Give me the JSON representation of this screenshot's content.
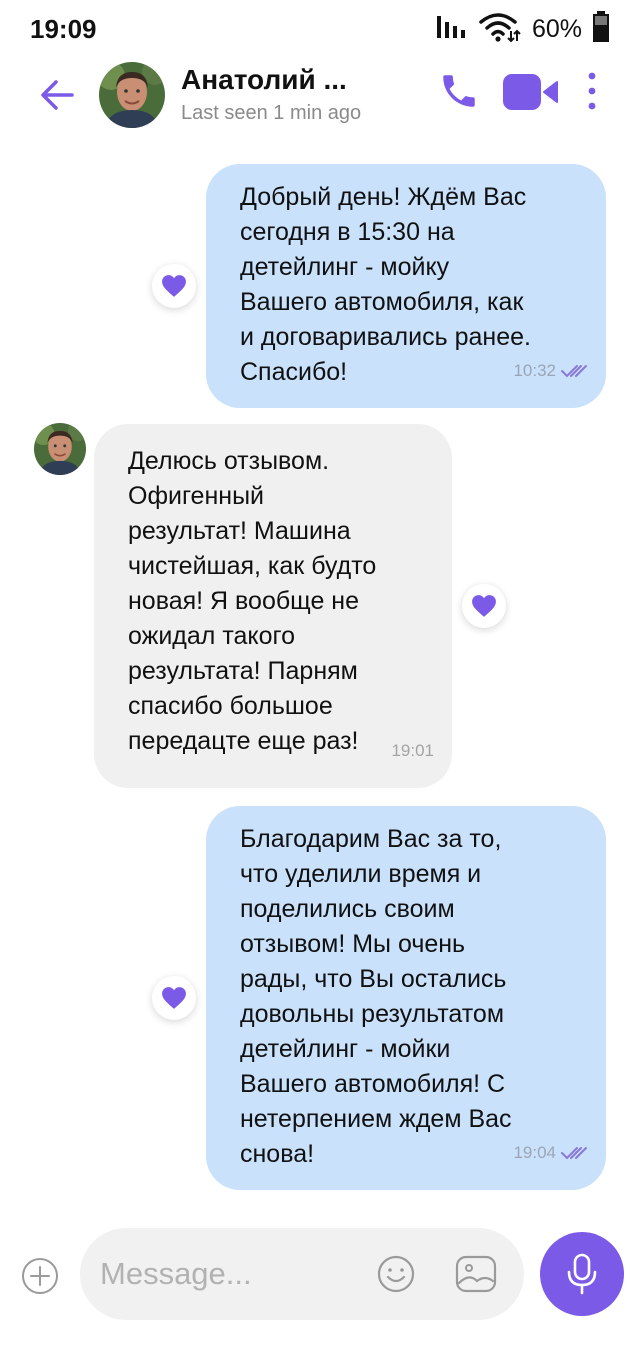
{
  "status_bar": {
    "time": "19:09",
    "battery_percent": "60%"
  },
  "header": {
    "contact_name": "Анатолий ...",
    "last_seen": "Last seen 1 min ago"
  },
  "messages": [
    {
      "direction": "outgoing",
      "text": "Добрый день! Ждём Вас\nсегодня в 15:30 на\nдетейлинг - мойку\nВашего автомобиля, как\nи договаривались ранее.\nСпасибо!",
      "time": "10:32",
      "read": true,
      "reaction": "heart"
    },
    {
      "direction": "incoming",
      "text": "Делюсь отзывом.\nОфигенный\nрезультат! Машина\nчистейшая, как будто\nновая! Я вообще не\nожидал такого\nрезультата! Парням\nспасибо большое\nпередацте еще раз!",
      "time": "19:01",
      "reaction": "heart"
    },
    {
      "direction": "outgoing",
      "text": "Благодарим Вас за то,\nчто уделили время и\nподелились своим\nотзывом! Мы очень\nрады, что Вы остались\nдовольны результатом\nдетейлинг - мойки\nВашего автомобиля! С\nнетерпением ждем Вас\nснова!",
      "time": "19:04",
      "read": true,
      "reaction": "heart"
    }
  ],
  "composer": {
    "placeholder": "Message..."
  },
  "colors": {
    "accent": "#7b5ae8",
    "outgoing_bubble": "#c9e1fb",
    "incoming_bubble": "#f0f0f0",
    "muted_text": "#8a8a8a"
  },
  "icons": {
    "back": "arrow-left-icon",
    "call": "phone-icon",
    "video": "video-camera-icon",
    "more": "more-vertical-icon",
    "attach": "plus-circle-icon",
    "emoji": "smiley-icon",
    "sticker": "sticker-icon",
    "mic": "microphone-icon",
    "reaction": "heart-icon",
    "read_receipt": "double-check-icon"
  }
}
